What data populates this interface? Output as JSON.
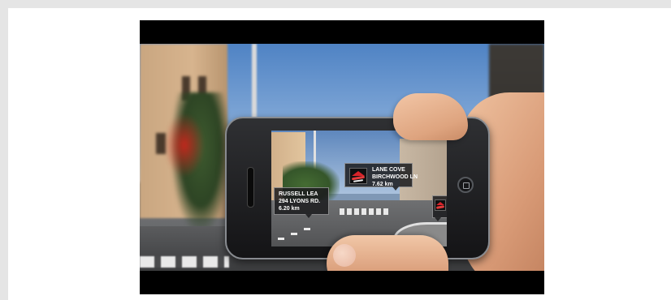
{
  "scene": {
    "description_icons": [
      "pizza-hut-logo"
    ],
    "poi_labels": [
      {
        "lines": [
          "LANE COVE",
          "BIRCHWOOD LN",
          "7.62 km"
        ]
      },
      {
        "lines": [
          "RUSSELL LEA",
          "294 LYONS RD.",
          "6.20 km"
        ]
      }
    ],
    "colors": {
      "frame": "#e5e5e5",
      "letterbox": "#000000",
      "label_bg": "#1c1c1e",
      "logo_red": "#d8232a"
    }
  }
}
